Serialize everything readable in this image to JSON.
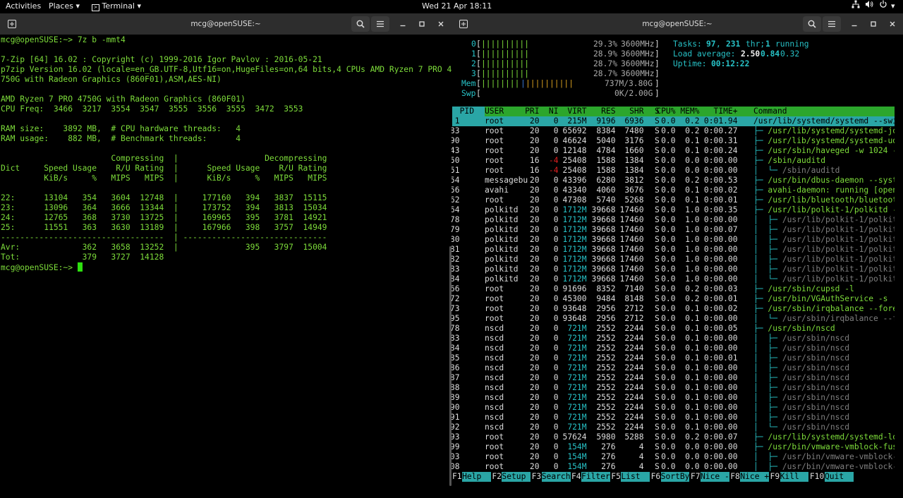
{
  "topbar": {
    "activities": "Activities",
    "places": "Places",
    "terminal": "Terminal",
    "clock": "Wed 21 Apr  18:11"
  },
  "left": {
    "title": "mcg@openSUSE:~",
    "lines": [
      "mcg@openSUSE:~> 7z b -mmt4",
      "",
      "7-Zip [64] 16.02 : Copyright (c) 1999-2016 Igor Pavlov : 2016-05-21",
      "p7zip Version 16.02 (locale=en_GB.UTF-8,Utf16=on,HugeFiles=on,64 bits,4 CPUs AMD Ryzen 7 PRO 4",
      "750G with Radeon Graphics (860F01),ASM,AES-NI)",
      "",
      "AMD Ryzen 7 PRO 4750G with Radeon Graphics (860F01)",
      "CPU Freq:  3466  3217  3554  3547  3555  3556  3555  3472  3553",
      "",
      "RAM size:    3892 MB,  # CPU hardware threads:   4",
      "RAM usage:    882 MB,  # Benchmark threads:      4",
      "",
      "                       Compressing  |                  Decompressing",
      "Dict     Speed Usage    R/U Rating  |      Speed Usage    R/U Rating",
      "         KiB/s     %   MIPS   MIPS  |      KiB/s     %   MIPS   MIPS",
      "",
      "22:      13104   354   3604  12748  |     177160   394   3837  15115",
      "23:      13096   364   3666  13344  |     173752   394   3813  15034",
      "24:      12765   368   3730  13725  |     169965   395   3781  14921",
      "25:      11551   363   3630  13189  |     167966   398   3757  14949",
      "----------------------------------  | ------------------------------",
      "Avr:             362   3658  13252  |              395   3797  15004",
      "Tot:             379   3727  14128"
    ],
    "prompt": "mcg@openSUSE:~> "
  },
  "right": {
    "title": "mcg@openSUSE:~",
    "cpus": [
      {
        "id": "0",
        "pct": "29.3%",
        "mhz": "3600MHz"
      },
      {
        "id": "1",
        "pct": "28.9%",
        "mhz": "3600MHz"
      },
      {
        "id": "2",
        "pct": "28.7%",
        "mhz": "3600MHz"
      },
      {
        "id": "3",
        "pct": "28.7%",
        "mhz": "3600MHz"
      }
    ],
    "mem": {
      "label": "Mem",
      "val": "737M/3.80G"
    },
    "swp": {
      "label": "Swp",
      "val": "0K/2.00G"
    },
    "tasks": {
      "label": "Tasks:",
      "procs": "97",
      "threads": "231",
      "thr": "thr;",
      "running": "1",
      "running_label": "running"
    },
    "load": {
      "label": "Load average:",
      "l1": "2.50",
      "l5": "0.84",
      "l15": "0.32"
    },
    "uptime": {
      "label": "Uptime:",
      "val": "00:12:22"
    },
    "columns": [
      "PID",
      "USER",
      "PRI",
      "NI",
      "VIRT",
      "RES",
      "SHR",
      "S",
      "CPU%",
      "MEM%",
      "TIME+",
      "Command"
    ],
    "rows": [
      {
        "pid": "1",
        "user": "root",
        "pri": "20",
        "ni": "0",
        "virt": "215M",
        "res": "9196",
        "shr": "6936",
        "s": "S",
        "cpu": "0.0",
        "mem": "0.2",
        "time": "0:01.94",
        "tree": "",
        "cmd": "/usr/lib/systemd/systemd --swi"
      },
      {
        "pid": "483",
        "user": "root",
        "pri": "20",
        "ni": "0",
        "virt": "65692",
        "res": "8384",
        "shr": "7480",
        "s": "S",
        "cpu": "0.0",
        "mem": "0.2",
        "time": "0:00.27",
        "tree": "├─ ",
        "cmd": "/usr/lib/systemd/systemd-jo"
      },
      {
        "pid": "490",
        "user": "root",
        "pri": "20",
        "ni": "0",
        "virt": "46624",
        "res": "5040",
        "shr": "3176",
        "s": "S",
        "cpu": "0.0",
        "mem": "0.1",
        "time": "0:00.31",
        "tree": "├─ ",
        "cmd": "/usr/lib/systemd/systemd-ud"
      },
      {
        "pid": "543",
        "user": "root",
        "pri": "20",
        "ni": "0",
        "virt": "12148",
        "res": "4784",
        "shr": "1660",
        "s": "S",
        "cpu": "0.0",
        "mem": "0.1",
        "time": "0:00.24",
        "tree": "├─ ",
        "cmd": "/usr/sbin/haveged -w 1024 -"
      },
      {
        "pid": "650",
        "user": "root",
        "pri": "16",
        "ni": "-4",
        "virt": "25408",
        "res": "1588",
        "shr": "1384",
        "s": "S",
        "cpu": "0.0",
        "mem": "0.0",
        "time": "0:00.00",
        "tree": "├─ ",
        "cmd": "/sbin/auditd"
      },
      {
        "pid": "651",
        "user": "root",
        "pri": "16",
        "ni": "-4",
        "virt": "25408",
        "res": "1588",
        "shr": "1384",
        "s": "S",
        "cpu": "0.0",
        "mem": "0.0",
        "time": "0:00.00",
        "tree": "│  └─ ",
        "cmd": "/sbin/auditd"
      },
      {
        "pid": "954",
        "user": "messagebu",
        "pri": "20",
        "ni": "0",
        "virt": "43396",
        "res": "6280",
        "shr": "3812",
        "s": "S",
        "cpu": "0.0",
        "mem": "0.2",
        "time": "0:00.53",
        "tree": "├─ ",
        "cmd": "/usr/bin/dbus-daemon --syst"
      },
      {
        "pid": "956",
        "user": "avahi",
        "pri": "20",
        "ni": "0",
        "virt": "43340",
        "res": "4060",
        "shr": "3676",
        "s": "S",
        "cpu": "0.0",
        "mem": "0.1",
        "time": "0:00.02",
        "tree": "├─ ",
        "cmd": "avahi-daemon: running [open"
      },
      {
        "pid": "962",
        "user": "root",
        "pri": "20",
        "ni": "0",
        "virt": "47308",
        "res": "5740",
        "shr": "5268",
        "s": "S",
        "cpu": "0.0",
        "mem": "0.1",
        "time": "0:00.01",
        "tree": "├─ ",
        "cmd": "/usr/lib/bluetooth/bluetoot"
      },
      {
        "pid": "964",
        "user": "polkitd",
        "pri": "20",
        "ni": "0",
        "virt": "1712M",
        "res": "39668",
        "shr": "17460",
        "s": "S",
        "cpu": "0.0",
        "mem": "1.0",
        "time": "0:00.35",
        "tree": "├─ ",
        "cmd": "/usr/lib/polkit-1/polkitd -"
      },
      {
        "pid": "1078",
        "user": "polkitd",
        "pri": "20",
        "ni": "0",
        "virt": "1712M",
        "res": "39668",
        "shr": "17460",
        "s": "S",
        "cpu": "0.0",
        "mem": "1.0",
        "time": "0:00.00",
        "tree": "│  ├─ ",
        "cmd": "/usr/lib/polkit-1/polkit"
      },
      {
        "pid": "1079",
        "user": "polkitd",
        "pri": "20",
        "ni": "0",
        "virt": "1712M",
        "res": "39668",
        "shr": "17460",
        "s": "S",
        "cpu": "0.0",
        "mem": "1.0",
        "time": "0:00.07",
        "tree": "│  ├─ ",
        "cmd": "/usr/lib/polkit-1/polkit"
      },
      {
        "pid": "1080",
        "user": "polkitd",
        "pri": "20",
        "ni": "0",
        "virt": "1712M",
        "res": "39668",
        "shr": "17460",
        "s": "S",
        "cpu": "0.0",
        "mem": "1.0",
        "time": "0:00.00",
        "tree": "│  ├─ ",
        "cmd": "/usr/lib/polkit-1/polkit"
      },
      {
        "pid": "1081",
        "user": "polkitd",
        "pri": "20",
        "ni": "0",
        "virt": "1712M",
        "res": "39668",
        "shr": "17460",
        "s": "S",
        "cpu": "0.0",
        "mem": "1.0",
        "time": "0:00.00",
        "tree": "│  ├─ ",
        "cmd": "/usr/lib/polkit-1/polkit"
      },
      {
        "pid": "1082",
        "user": "polkitd",
        "pri": "20",
        "ni": "0",
        "virt": "1712M",
        "res": "39668",
        "shr": "17460",
        "s": "S",
        "cpu": "0.0",
        "mem": "1.0",
        "time": "0:00.00",
        "tree": "│  ├─ ",
        "cmd": "/usr/lib/polkit-1/polkit"
      },
      {
        "pid": "1083",
        "user": "polkitd",
        "pri": "20",
        "ni": "0",
        "virt": "1712M",
        "res": "39668",
        "shr": "17460",
        "s": "S",
        "cpu": "0.0",
        "mem": "1.0",
        "time": "0:00.00",
        "tree": "│  ├─ ",
        "cmd": "/usr/lib/polkit-1/polkit"
      },
      {
        "pid": "1084",
        "user": "polkitd",
        "pri": "20",
        "ni": "0",
        "virt": "1712M",
        "res": "39668",
        "shr": "17460",
        "s": "S",
        "cpu": "0.0",
        "mem": "1.0",
        "time": "0:00.00",
        "tree": "│  └─ ",
        "cmd": "/usr/lib/polkit-1/polkit"
      },
      {
        "pid": "966",
        "user": "root",
        "pri": "20",
        "ni": "0",
        "virt": "91696",
        "res": "8352",
        "shr": "7140",
        "s": "S",
        "cpu": "0.0",
        "mem": "0.2",
        "time": "0:00.03",
        "tree": "├─ ",
        "cmd": "/usr/sbin/cupsd -l"
      },
      {
        "pid": "972",
        "user": "root",
        "pri": "20",
        "ni": "0",
        "virt": "45300",
        "res": "9484",
        "shr": "8148",
        "s": "S",
        "cpu": "0.0",
        "mem": "0.2",
        "time": "0:00.01",
        "tree": "├─ ",
        "cmd": "/usr/bin/VGAuthService -s"
      },
      {
        "pid": "973",
        "user": "root",
        "pri": "20",
        "ni": "0",
        "virt": "93648",
        "res": "2956",
        "shr": "2712",
        "s": "S",
        "cpu": "0.0",
        "mem": "0.1",
        "time": "0:00.02",
        "tree": "├─ ",
        "cmd": "/usr/sbin/irqbalance --fore"
      },
      {
        "pid": "995",
        "user": "root",
        "pri": "20",
        "ni": "0",
        "virt": "93648",
        "res": "2956",
        "shr": "2712",
        "s": "S",
        "cpu": "0.0",
        "mem": "0.1",
        "time": "0:00.00",
        "tree": "│  └─ ",
        "cmd": "/usr/sbin/irqbalance --f"
      },
      {
        "pid": "978",
        "user": "nscd",
        "pri": "20",
        "ni": "0",
        "virt": "721M",
        "res": "2552",
        "shr": "2244",
        "s": "S",
        "cpu": "0.0",
        "mem": "0.1",
        "time": "0:00.05",
        "tree": "├─ ",
        "cmd": "/usr/sbin/nscd"
      },
      {
        "pid": "983",
        "user": "nscd",
        "pri": "20",
        "ni": "0",
        "virt": "721M",
        "res": "2552",
        "shr": "2244",
        "s": "S",
        "cpu": "0.0",
        "mem": "0.1",
        "time": "0:00.00",
        "tree": "│  ├─ ",
        "cmd": "/usr/sbin/nscd"
      },
      {
        "pid": "984",
        "user": "nscd",
        "pri": "20",
        "ni": "0",
        "virt": "721M",
        "res": "2552",
        "shr": "2244",
        "s": "S",
        "cpu": "0.0",
        "mem": "0.1",
        "time": "0:00.00",
        "tree": "│  ├─ ",
        "cmd": "/usr/sbin/nscd"
      },
      {
        "pid": "985",
        "user": "nscd",
        "pri": "20",
        "ni": "0",
        "virt": "721M",
        "res": "2552",
        "shr": "2244",
        "s": "S",
        "cpu": "0.0",
        "mem": "0.1",
        "time": "0:00.01",
        "tree": "│  ├─ ",
        "cmd": "/usr/sbin/nscd"
      },
      {
        "pid": "986",
        "user": "nscd",
        "pri": "20",
        "ni": "0",
        "virt": "721M",
        "res": "2552",
        "shr": "2244",
        "s": "S",
        "cpu": "0.0",
        "mem": "0.1",
        "time": "0:00.00",
        "tree": "│  ├─ ",
        "cmd": "/usr/sbin/nscd"
      },
      {
        "pid": "987",
        "user": "nscd",
        "pri": "20",
        "ni": "0",
        "virt": "721M",
        "res": "2552",
        "shr": "2244",
        "s": "S",
        "cpu": "0.0",
        "mem": "0.1",
        "time": "0:00.00",
        "tree": "│  ├─ ",
        "cmd": "/usr/sbin/nscd"
      },
      {
        "pid": "988",
        "user": "nscd",
        "pri": "20",
        "ni": "0",
        "virt": "721M",
        "res": "2552",
        "shr": "2244",
        "s": "S",
        "cpu": "0.0",
        "mem": "0.1",
        "time": "0:00.00",
        "tree": "│  ├─ ",
        "cmd": "/usr/sbin/nscd"
      },
      {
        "pid": "989",
        "user": "nscd",
        "pri": "20",
        "ni": "0",
        "virt": "721M",
        "res": "2552",
        "shr": "2244",
        "s": "S",
        "cpu": "0.0",
        "mem": "0.1",
        "time": "0:00.00",
        "tree": "│  ├─ ",
        "cmd": "/usr/sbin/nscd"
      },
      {
        "pid": "990",
        "user": "nscd",
        "pri": "20",
        "ni": "0",
        "virt": "721M",
        "res": "2552",
        "shr": "2244",
        "s": "S",
        "cpu": "0.0",
        "mem": "0.1",
        "time": "0:00.00",
        "tree": "│  ├─ ",
        "cmd": "/usr/sbin/nscd"
      },
      {
        "pid": "991",
        "user": "nscd",
        "pri": "20",
        "ni": "0",
        "virt": "721M",
        "res": "2552",
        "shr": "2244",
        "s": "S",
        "cpu": "0.0",
        "mem": "0.1",
        "time": "0:00.00",
        "tree": "│  ├─ ",
        "cmd": "/usr/sbin/nscd"
      },
      {
        "pid": "992",
        "user": "nscd",
        "pri": "20",
        "ni": "0",
        "virt": "721M",
        "res": "2552",
        "shr": "2244",
        "s": "S",
        "cpu": "0.0",
        "mem": "0.1",
        "time": "0:00.00",
        "tree": "│  └─ ",
        "cmd": "/usr/sbin/nscd"
      },
      {
        "pid": "993",
        "user": "root",
        "pri": "20",
        "ni": "0",
        "virt": "57624",
        "res": "5980",
        "shr": "5288",
        "s": "S",
        "cpu": "0.0",
        "mem": "0.2",
        "time": "0:00.07",
        "tree": "├─ ",
        "cmd": "/usr/lib/systemd/systemd-lo"
      },
      {
        "pid": "999",
        "user": "root",
        "pri": "20",
        "ni": "0",
        "virt": "154M",
        "res": "276",
        "shr": "4",
        "s": "S",
        "cpu": "0.0",
        "mem": "0.0",
        "time": "0:00.00",
        "tree": "├─ ",
        "cmd": "/usr/bin/vmware-vmblock-fus"
      },
      {
        "pid": "1003",
        "user": "root",
        "pri": "20",
        "ni": "0",
        "virt": "154M",
        "res": "276",
        "shr": "4",
        "s": "S",
        "cpu": "0.0",
        "mem": "0.0",
        "time": "0:00.00",
        "tree": "│  ├─ ",
        "cmd": "/usr/bin/vmware-vmblock-"
      },
      {
        "pid": "1008",
        "user": "root",
        "pri": "20",
        "ni": "0",
        "virt": "154M",
        "res": "276",
        "shr": "4",
        "s": "S",
        "cpu": "0.0",
        "mem": "0.0",
        "time": "0:00.00",
        "tree": "│  ├─ ",
        "cmd": "/usr/bin/vmware-vmblock-"
      }
    ],
    "fkeys": [
      {
        "k": "F1",
        "l": "Help  "
      },
      {
        "k": "F2",
        "l": "Setup "
      },
      {
        "k": "F3",
        "l": "Search"
      },
      {
        "k": "F4",
        "l": "Filter"
      },
      {
        "k": "F5",
        "l": "List  "
      },
      {
        "k": "F6",
        "l": "SortBy"
      },
      {
        "k": "F7",
        "l": "Nice -"
      },
      {
        "k": "F8",
        "l": "Nice +"
      },
      {
        "k": "F9",
        "l": "Kill  "
      },
      {
        "k": "F10",
        "l": "Quit  "
      }
    ]
  },
  "colors": {
    "green": "#7ddc3a",
    "cyan": "#27c1c6",
    "header_bg": "#2d2d2d",
    "selected": "#2aa6a6",
    "col_header": "#2ca62c",
    "neg_nice": "#e02020",
    "tree": "#27c1c6"
  }
}
